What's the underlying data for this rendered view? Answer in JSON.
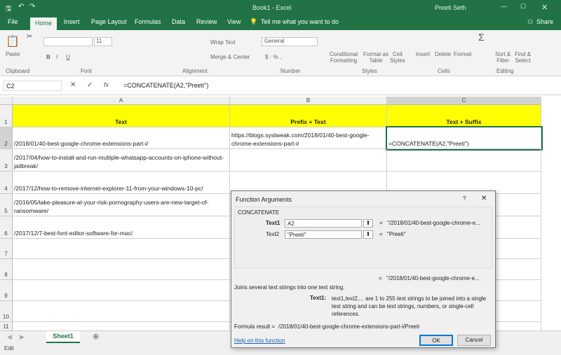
{
  "title": "Book1 - Excel",
  "user": "Preeti Seth",
  "tabs": [
    "File",
    "Home",
    "Insert",
    "Page Layout",
    "Formulas",
    "Data",
    "Review",
    "View"
  ],
  "tell_me": "Tell me what you want to do",
  "share": "Share",
  "ribbon": {
    "paste": "Paste",
    "font_size": "11",
    "wrap_text": "Wrap Text",
    "merge_center": "Merge & Center",
    "number_format": "General",
    "conditional_formatting": [
      "Conditional",
      "Formatting"
    ],
    "format_as_table": [
      "Format as",
      "Table"
    ],
    "cell_styles": [
      "Cell",
      "Styles"
    ],
    "insert": "Insert",
    "delete": "Delete",
    "format": "Format",
    "sort_filter": [
      "Sort &",
      "Filter"
    ],
    "find_select": [
      "Find &",
      "Select"
    ],
    "groups": [
      "Clipboard",
      "Font",
      "Alignment",
      "Number",
      "Styles",
      "Cells",
      "Editing"
    ]
  },
  "formula_bar": {
    "name_box": "C2",
    "formula": "=CONCATENATE(A2,\"Preeti\")"
  },
  "columns": [
    "A",
    "B",
    "C"
  ],
  "rows": [
    "1",
    "2",
    "3",
    "4",
    "5",
    "6",
    "7",
    "8",
    "9",
    "10",
    "11"
  ],
  "cells": {
    "A1": "Text",
    "B1": "Prefix + Text",
    "C1": "Text + Suffix",
    "A2": "/2018/01/40-best-google-chrome-extensions-part-i/",
    "B2": "https://blogs.systweak.com/2018/01/40-best-google-chrome-extensions-part-i/",
    "C2": "=CONCATENATE(A2,\"Preeti\")",
    "A3": "/2017/04/how-to-install-and-run-multiple-whatsapp-accounts-on-iphone-without-jailbreak/",
    "A4": "/2017/12/how-to-remove-internet-explorer-11-from-your-windows-10-pc/",
    "A5": "/2016/05/take-pleasure-at-your-risk-pornography-users-are-new-target-of-ransomware/",
    "A6": "/2017/12/7-best-font-editor-software-for-mac/"
  },
  "sheet_tab": "Sheet1",
  "status": "Edit",
  "dialog": {
    "title": "Function Arguments",
    "help": "?",
    "function_name": "CONCATENATE",
    "args": [
      {
        "label": "Text1",
        "value": "A2",
        "result": "\"/2018/01/40-best-google-chrome-e..."
      },
      {
        "label": "Text2",
        "value": "\"Preeti\"",
        "result": "\"Preeti\""
      }
    ],
    "eq": "=",
    "overall_result": "\"/2018/01/40-best-google-chrome-e...",
    "description": "Joins several text strings into one text string.",
    "arg_help_label": "Text1:",
    "arg_help": "text1,text2,... are 1 to 255 text strings to be joined into a single text string and can be text strings, numbers, or single-cell references.",
    "formula_result_label": "Formula result =",
    "formula_result": "/2018/01/40-best-google-chrome-extensions-part-i/Preeti",
    "help_link": "Help on this function",
    "ok": "OK",
    "cancel": "Cancel"
  }
}
